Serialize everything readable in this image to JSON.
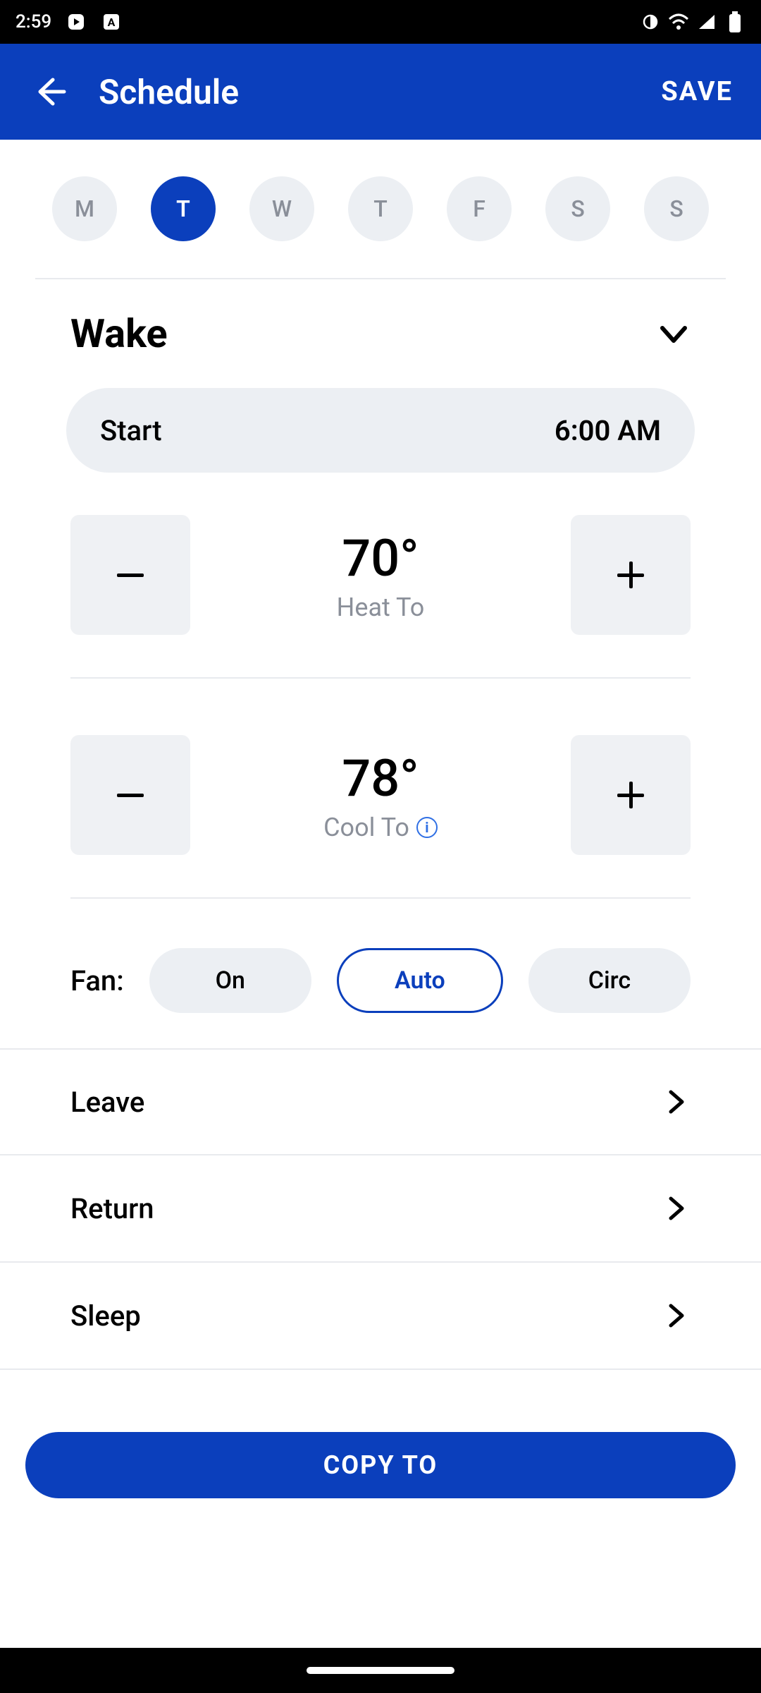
{
  "status_bar": {
    "time": "2:59",
    "icons_left": [
      "round-play-icon",
      "square-a-icon"
    ],
    "icons_right": [
      "theme-icon",
      "wifi-icon",
      "signal-icon",
      "battery-icon"
    ]
  },
  "header": {
    "title": "Schedule",
    "save_label": "SAVE"
  },
  "days": [
    {
      "label": "M",
      "selected": false
    },
    {
      "label": "T",
      "selected": true
    },
    {
      "label": "W",
      "selected": false
    },
    {
      "label": "T",
      "selected": false
    },
    {
      "label": "F",
      "selected": false
    },
    {
      "label": "S",
      "selected": false
    },
    {
      "label": "S",
      "selected": false
    }
  ],
  "wake": {
    "title": "Wake",
    "start_label": "Start",
    "start_time": "6:00 AM",
    "heat_value": "70°",
    "heat_label": "Heat To",
    "cool_value": "78°",
    "cool_label": "Cool To"
  },
  "fan": {
    "label": "Fan:",
    "options": [
      {
        "label": "On",
        "active": false
      },
      {
        "label": "Auto",
        "active": true
      },
      {
        "label": "Circ",
        "active": false
      }
    ]
  },
  "periods": [
    {
      "label": "Leave"
    },
    {
      "label": "Return"
    },
    {
      "label": "Sleep"
    }
  ],
  "copy_label": "COPY TO"
}
